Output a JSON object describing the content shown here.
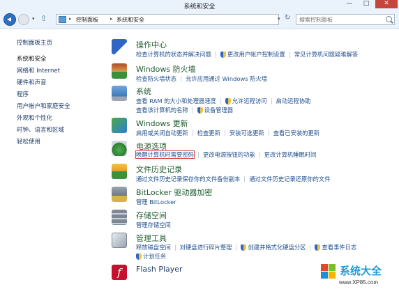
{
  "window": {
    "title": "系统和安全",
    "minimize": "—",
    "maximize": "□",
    "close": "✕"
  },
  "address": {
    "crumbs": [
      "控制面板",
      "系统和安全"
    ],
    "separator": "▸"
  },
  "search": {
    "placeholder": "搜索控制面板"
  },
  "sidebar": {
    "items": [
      {
        "label": "控制面板主页",
        "active": false
      },
      {
        "label": "系统和安全",
        "active": true
      },
      {
        "label": "网络和 Internet",
        "active": false
      },
      {
        "label": "硬件和声音",
        "active": false
      },
      {
        "label": "程序",
        "active": false
      },
      {
        "label": "用户帐户和家庭安全",
        "active": false
      },
      {
        "label": "外观和个性化",
        "active": false
      },
      {
        "label": "时钟、语言和区域",
        "active": false
      },
      {
        "label": "轻松使用",
        "active": false
      }
    ]
  },
  "categories": [
    {
      "title": "操作中心",
      "icon": "action-center-flag-icon",
      "lines": [
        [
          "检查计算机的状态并解决问题",
          "更改用户帐户控制设置",
          "常见计算机问题疑难解答"
        ]
      ]
    },
    {
      "title": "Windows 防火墙",
      "icon": "firewall-icon",
      "lines": [
        [
          "检查防火墙状态",
          "允许应用通过 Windows 防火墙"
        ]
      ]
    },
    {
      "title": "系统",
      "icon": "system-computer-icon",
      "lines": [
        [
          "查看 RAM 的大小和处理器速度",
          "允许远程访问",
          "启动远程协助"
        ],
        [
          "查看该计算机的名称",
          "设备管理器"
        ]
      ]
    },
    {
      "title": "Windows 更新",
      "icon": "windows-update-icon",
      "lines": [
        [
          "启用或关闭自动更新",
          "检查更新",
          "安装可选更新",
          "查看已安装的更新"
        ]
      ]
    },
    {
      "title": "电源选项",
      "icon": "power-options-icon",
      "lines": [
        [
          "唤醒计算机时需要密码",
          "更改电源按钮的功能",
          "更改计算机睡眠时间"
        ]
      ]
    },
    {
      "title": "文件历史记录",
      "icon": "file-history-icon",
      "lines": [
        [
          "通过文件历史记录保存你的文件备份副本",
          "通过文件历史记录还原你的文件"
        ]
      ]
    },
    {
      "title": "BitLocker 驱动器加密",
      "icon": "bitlocker-icon",
      "lines": [
        [
          "管理 BitLocker"
        ]
      ]
    },
    {
      "title": "存储空间",
      "icon": "storage-spaces-icon",
      "lines": [
        [
          "管理存储空间"
        ]
      ]
    },
    {
      "title": "管理工具",
      "icon": "admin-tools-icon",
      "lines": [
        [
          "释放磁盘空间",
          "对硬盘进行碎片整理",
          "创建并格式化硬盘分区",
          "查看事件日志"
        ],
        [
          "计划任务"
        ]
      ]
    },
    {
      "title": "Flash Player",
      "icon": "flash-player-icon",
      "lines": []
    }
  ],
  "watermark": {
    "text": "系统大全",
    "url": "www.XP85.com"
  },
  "colors": {
    "accent": "#2f6fc1",
    "link": "#1f4e8c",
    "category_title": "#1e5b2e",
    "highlight": "#e23b3b"
  }
}
